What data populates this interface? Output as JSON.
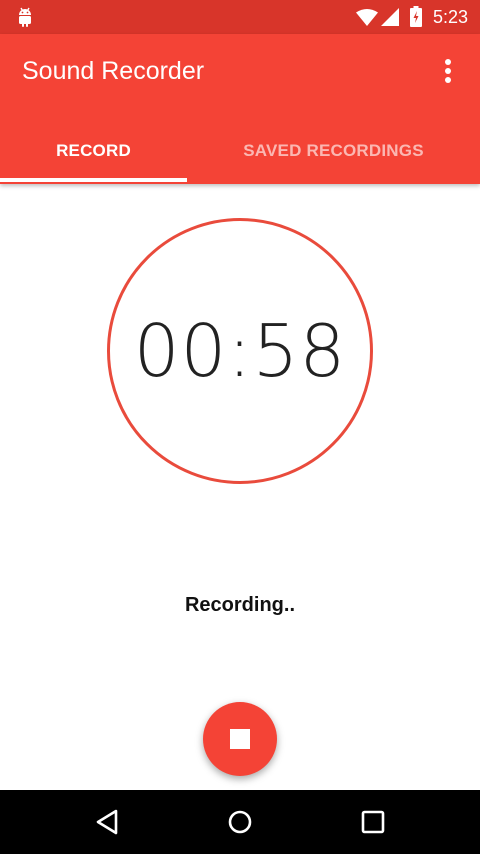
{
  "status_bar": {
    "time": "5:23",
    "icons": [
      "android-icon",
      "wifi-icon",
      "signal-icon",
      "battery-charging-icon"
    ]
  },
  "app_bar": {
    "title": "Sound Recorder",
    "menu_icon": "more-vert-icon",
    "color": "#f44336"
  },
  "tabs": [
    {
      "label": "RECORD",
      "selected": true
    },
    {
      "label": "SAVED RECORDINGS",
      "selected": false
    }
  ],
  "timer": {
    "value": "00:58",
    "ring_color": "#e94b3c"
  },
  "status": {
    "label": "Recording.."
  },
  "fab": {
    "icon": "stop-icon",
    "color": "#f44336"
  },
  "nav_bar": {
    "buttons": [
      "back-icon",
      "home-icon",
      "recents-icon"
    ]
  }
}
